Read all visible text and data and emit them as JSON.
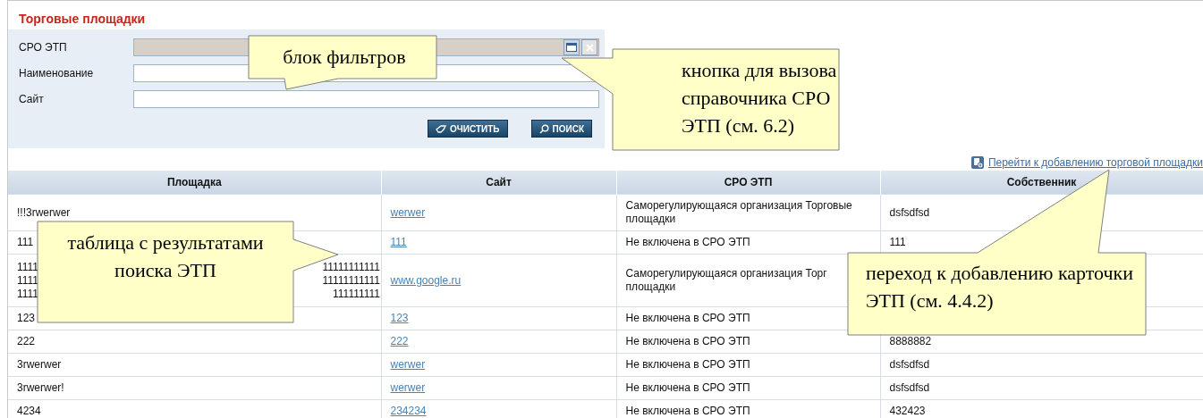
{
  "title": "Торговые площадки",
  "filters": [
    {
      "label": "СРО ЭТП",
      "kind": "lookup"
    },
    {
      "label": "Наименование",
      "kind": "text"
    },
    {
      "label": "Сайт",
      "kind": "text"
    }
  ],
  "buttons": [
    {
      "label": "ОЧИСТИТЬ",
      "kind": "clear"
    },
    {
      "label": "ПОИСК",
      "kind": "search"
    }
  ],
  "add_link": "Перейти к добавлению торговой площадки",
  "table": {
    "columns": [
      "Площадка",
      "Сайт",
      "СРО ЭТП",
      "Собственник"
    ],
    "rows": [
      {
        "name": [
          "!!!3rwerwer"
        ],
        "site": "werwer",
        "sro": "Саморегулирующаяся организация Торговые площадки",
        "owner": "dsfsdfsd"
      },
      {
        "name": [
          "111"
        ],
        "site": "111",
        "sro": "Не включена в СРО ЭТП",
        "owner": "111"
      },
      {
        "name": [
          "1111 11111111111",
          "1111 11111111111",
          "1111 111111111"
        ],
        "site": "www.google.ru",
        "sro": "Саморегулирующаяся организация Торг\nплощадки"
      },
      {
        "name": [
          "123"
        ],
        "site": "123",
        "sro": "Не включена в СРО ЭТП"
      },
      {
        "name": [
          "222"
        ],
        "site": "222",
        "sro": "Не включена в СРО ЭТП",
        "owner": "8888882"
      },
      {
        "name": [
          "3rwerwer"
        ],
        "site": "werwer",
        "sro": "Не включена в СРО ЭТП",
        "owner": "dsfsdfsd"
      },
      {
        "name": [
          "3rwerwer!"
        ],
        "site": "werwer",
        "sro": "Не включена в СРО ЭТП",
        "owner": "dsfsdfsd"
      },
      {
        "name": [
          "4234"
        ],
        "site": "234234",
        "sro": "Не включена в СРО ЭТП",
        "owner": "432423"
      }
    ]
  },
  "callouts": [
    {
      "text": "блок фильтров",
      "kind": "down"
    },
    {
      "text": "кнопка для вызова справочника СРО ЭТП (см. 6.2)",
      "kind": "left"
    },
    {
      "text": "таблица с результатами поиска ЭТП",
      "kind": "right"
    },
    {
      "text": "переход к добавлению карточки ЭТП (см. 4.4.2)",
      "kind": "up"
    }
  ]
}
